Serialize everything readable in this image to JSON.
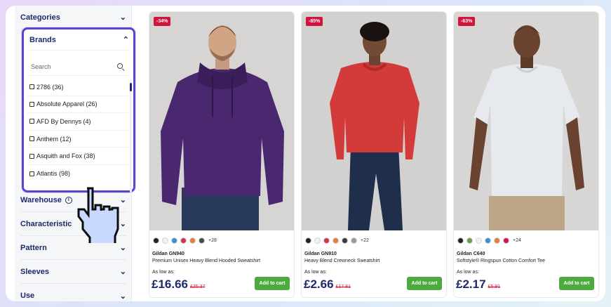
{
  "sidebar": {
    "filters": [
      {
        "label": "Categories",
        "chevron": "chevron-down"
      },
      {
        "label": "Brands",
        "chevron": "chevron-up"
      },
      {
        "label": "Warehouse",
        "chevron": "chevron-down"
      },
      {
        "label": "Characteristic",
        "chevron": "chevron-down"
      },
      {
        "label": "Pattern",
        "chevron": "chevron-down"
      },
      {
        "label": "Sleeves",
        "chevron": "chevron-down"
      },
      {
        "label": "Use",
        "chevron": "chevron-down"
      }
    ],
    "brands": {
      "search_placeholder": "Search",
      "items": [
        "2786 (36)",
        "Absolute Apparel (26)",
        "AFD By Dennys (4)",
        "Anthem (12)",
        "Asquith and Fox (38)",
        "Atlantis (98)"
      ]
    },
    "warehouse_info_icon": "info-icon"
  },
  "products": [
    {
      "discount": "-34%",
      "image_color": "#4a2870",
      "swatches": [
        "#222222",
        "#f2f2f2",
        "#3f8fcf",
        "#d6334a",
        "#ee7b35",
        "#4a4a4a"
      ],
      "more": "+28",
      "code": "Gildan GN940",
      "name": "Premium Unisex Heavy Blend Hooded Sweatshirt",
      "low_label": "As low as:",
      "price": "£16.66",
      "old_price": "£25.37",
      "cart_label": "Add to cart"
    },
    {
      "discount": "-85%",
      "image_color": "#d33b3b",
      "swatches": [
        "#222222",
        "#f2f2f2",
        "#d6334a",
        "#ee7b35",
        "#3a3a3a",
        "#9a9a9a"
      ],
      "more": "+22",
      "code": "Gildan GN910",
      "name": "Heavy Blend Crewneck Sweatshirt",
      "low_label": "As low as:",
      "price": "£2.66",
      "old_price": "£17.81",
      "cart_label": "Add to cart"
    },
    {
      "discount": "-63%",
      "image_color": "#e4e8ee",
      "swatches": [
        "#222222",
        "#6f9e46",
        "#f2f2f2",
        "#3f8fcf",
        "#ee7b35",
        "#d6134a"
      ],
      "more": "+24",
      "code": "Gildan C640",
      "name": "Softstyle® Ringspun Cotton Comfort Tee",
      "low_label": "As low as:",
      "price": "£2.17",
      "old_price": "£5.91",
      "cart_label": "Add to cart"
    }
  ]
}
